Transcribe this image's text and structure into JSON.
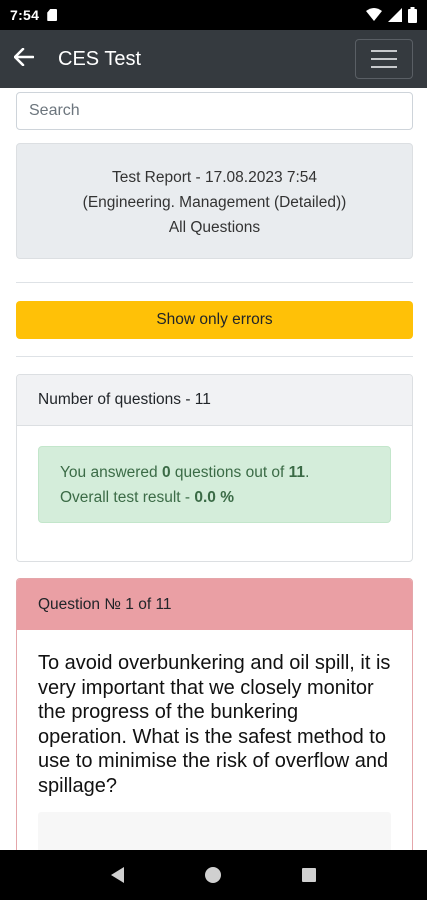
{
  "status": {
    "time": "7:54"
  },
  "app_bar": {
    "title": "CES Test"
  },
  "search": {
    "placeholder": "Search"
  },
  "report": {
    "line1": "Test Report - 17.08.2023 7:54",
    "line2": "(Engineering. Management (Detailed))",
    "line3": "All Questions"
  },
  "errors_button": {
    "label": "Show only errors"
  },
  "summary": {
    "header": "Number of questions - 11",
    "answered_prefix": "You answered ",
    "answered_count": "0",
    "answered_mid": " questions out of ",
    "total": "11",
    "answered_suffix": ".",
    "result_prefix": "Overall test result - ",
    "result_value": "0.0 %"
  },
  "question": {
    "header": "Question № 1 of 11",
    "text": "To avoid overbunkering and oil spill, it is very important that we closely monitor the progress of the bunkering operation. What is the safest method to use to minimise the risk of overflow and spillage?"
  },
  "icons": {
    "back": "arrow-left-icon",
    "menu": "hamburger-menu-icon",
    "wifi": "wifi-icon",
    "signal": "signal-icon",
    "battery": "battery-icon"
  }
}
